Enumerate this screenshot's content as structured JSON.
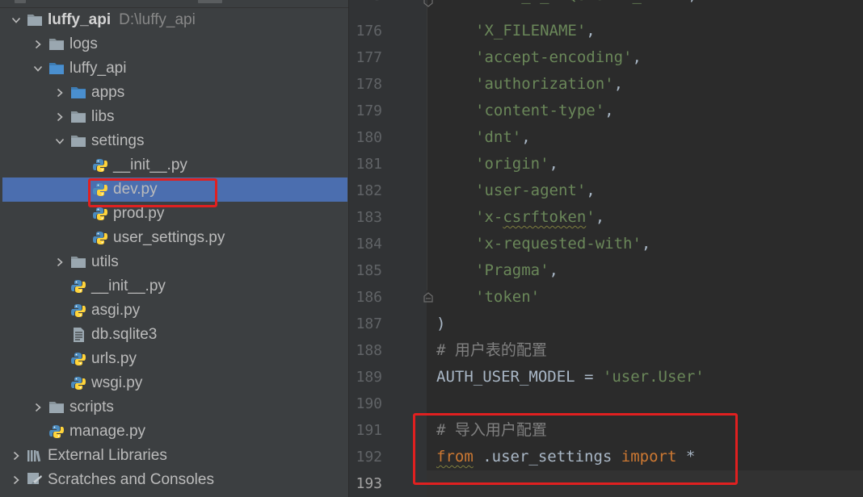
{
  "project_tree": {
    "items": [
      {
        "label": "luffy_api",
        "path": "D:\\luffy_api",
        "type": "folder",
        "expanded": true,
        "level": 0,
        "bold": true
      },
      {
        "label": "logs",
        "type": "folder",
        "expanded": false,
        "level": 1
      },
      {
        "label": "luffy_api",
        "type": "folder",
        "expanded": true,
        "level": 1
      },
      {
        "label": "apps",
        "type": "folder",
        "expanded": false,
        "level": 2
      },
      {
        "label": "libs",
        "type": "folder",
        "expanded": false,
        "level": 2
      },
      {
        "label": "settings",
        "type": "folder",
        "expanded": true,
        "level": 2
      },
      {
        "label": "__init__.py",
        "type": "python",
        "level": 3
      },
      {
        "label": "dev.py",
        "type": "python",
        "level": 3,
        "selected": true
      },
      {
        "label": "prod.py",
        "type": "python",
        "level": 3
      },
      {
        "label": "user_settings.py",
        "type": "python",
        "level": 3
      },
      {
        "label": "utils",
        "type": "folder",
        "expanded": false,
        "level": 2
      },
      {
        "label": "__init__.py",
        "type": "python",
        "level": 2
      },
      {
        "label": "asgi.py",
        "type": "python",
        "level": 2
      },
      {
        "label": "db.sqlite3",
        "type": "file",
        "level": 2
      },
      {
        "label": "urls.py",
        "type": "python",
        "level": 2
      },
      {
        "label": "wsgi.py",
        "type": "python",
        "level": 2
      },
      {
        "label": "scripts",
        "type": "folder",
        "expanded": false,
        "level": 1
      },
      {
        "label": "manage.py",
        "type": "python",
        "level": 1
      },
      {
        "label": "External Libraries",
        "type": "libraries",
        "expanded": false,
        "level": 0
      },
      {
        "label": "Scratches and Consoles",
        "type": "scratches",
        "expanded": false,
        "level": 0
      }
    ]
  },
  "editor": {
    "current_line": "193",
    "lines": [
      {
        "no": "176",
        "tokens": [
          {
            "t": "str",
            "v": "'X_FILENAME'"
          },
          {
            "t": "op",
            "v": ","
          }
        ]
      },
      {
        "no": "177",
        "tokens": [
          {
            "t": "str",
            "v": "'accept-encoding'"
          },
          {
            "t": "op",
            "v": ","
          }
        ]
      },
      {
        "no": "178",
        "tokens": [
          {
            "t": "str",
            "v": "'authorization'"
          },
          {
            "t": "op",
            "v": ","
          }
        ]
      },
      {
        "no": "179",
        "tokens": [
          {
            "t": "str",
            "v": "'content-type'"
          },
          {
            "t": "op",
            "v": ","
          }
        ]
      },
      {
        "no": "180",
        "tokens": [
          {
            "t": "str",
            "v": "'dnt'"
          },
          {
            "t": "op",
            "v": ","
          }
        ]
      },
      {
        "no": "181",
        "tokens": [
          {
            "t": "str",
            "v": "'origin'"
          },
          {
            "t": "op",
            "v": ","
          }
        ]
      },
      {
        "no": "182",
        "tokens": [
          {
            "t": "str",
            "v": "'user-agent'"
          },
          {
            "t": "op",
            "v": ","
          }
        ]
      },
      {
        "no": "183",
        "tokens": [
          {
            "t": "str",
            "v": "'x-"
          },
          {
            "t": "str sq",
            "v": "csrftoken"
          },
          {
            "t": "str",
            "v": "'"
          },
          {
            "t": "op",
            "v": ","
          }
        ]
      },
      {
        "no": "184",
        "tokens": [
          {
            "t": "str",
            "v": "'x-requested-with'"
          },
          {
            "t": "op",
            "v": ","
          }
        ]
      },
      {
        "no": "185",
        "tokens": [
          {
            "t": "str",
            "v": "'Pragma'"
          },
          {
            "t": "op",
            "v": ","
          }
        ]
      },
      {
        "no": "186",
        "tokens": [
          {
            "t": "str",
            "v": "'token'"
          }
        ]
      },
      {
        "no": "187",
        "tokens": [
          {
            "t": "op",
            "v": ")"
          }
        ]
      },
      {
        "no": "188",
        "tokens": [
          {
            "t": "cmt",
            "v": "# 用户表的配置"
          }
        ]
      },
      {
        "no": "189",
        "tokens": [
          {
            "t": "ident",
            "v": "AUTH_USER_MODEL"
          },
          {
            "t": "op",
            "v": " = "
          },
          {
            "t": "str",
            "v": "'user.User'"
          }
        ]
      },
      {
        "no": "190",
        "tokens": []
      },
      {
        "no": "191",
        "tokens": [
          {
            "t": "cmt",
            "v": "# 导入用户配置"
          }
        ]
      },
      {
        "no": "192",
        "tokens": [
          {
            "t": "kw sq",
            "v": "from"
          },
          {
            "t": "ident",
            "v": " .user_settings "
          },
          {
            "t": "kw",
            "v": "import"
          },
          {
            "t": "op",
            "v": " *"
          }
        ]
      },
      {
        "no": "193",
        "tokens": []
      }
    ]
  },
  "colors": {
    "tree_bg": "#3c3f41",
    "selection": "#4b6eaf",
    "editor_bg": "#2b2b2b",
    "gutter_bg": "#313335",
    "string": "#6a8759",
    "keyword": "#cc7832",
    "comment": "#808080",
    "highlight_box": "#e02020"
  }
}
